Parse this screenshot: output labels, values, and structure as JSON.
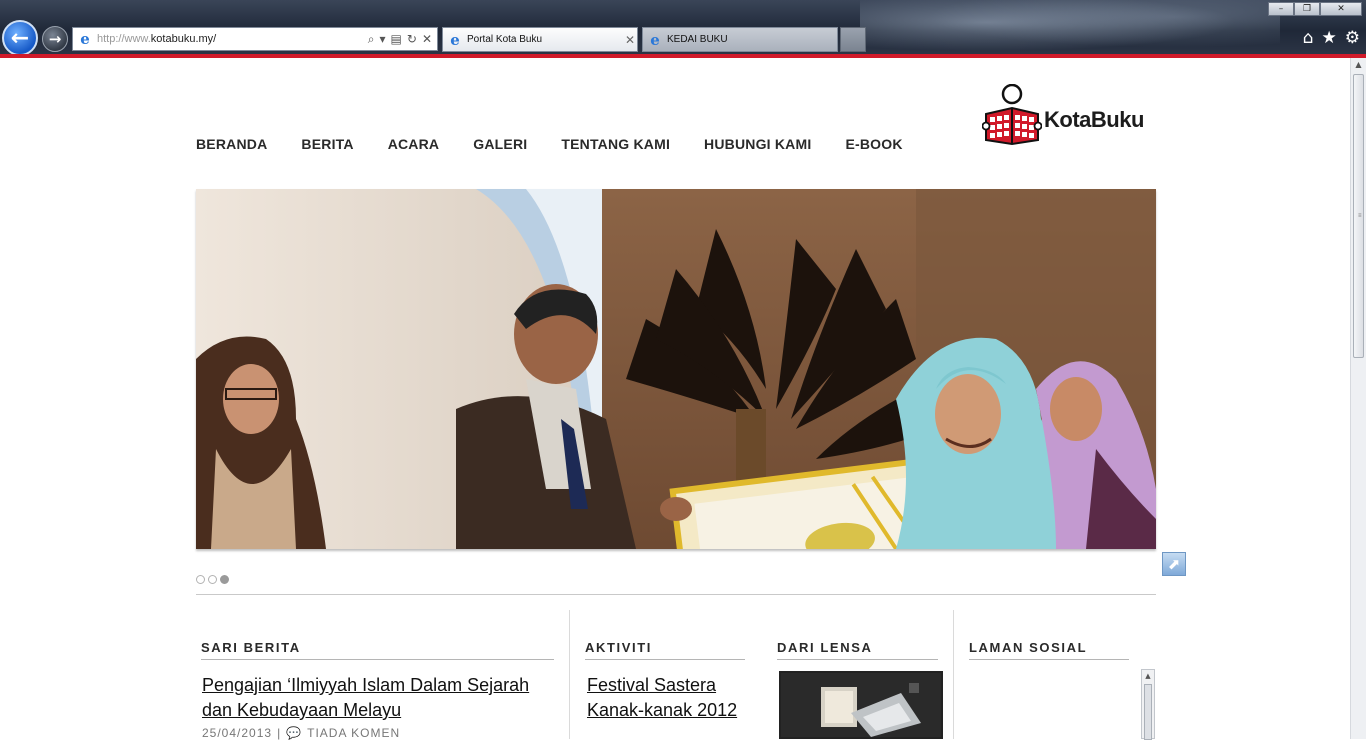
{
  "browser": {
    "address": {
      "prefix": "http://www.",
      "domain": "kotabuku.my/"
    },
    "tabs": [
      {
        "label": "Portal Kota Buku",
        "active": true
      },
      {
        "label": "KEDAI BUKU",
        "active": false
      }
    ]
  },
  "site": {
    "logo_text": "KotaBuku",
    "nav": [
      "BERANDA",
      "BERITA",
      "ACARA",
      "GALERI",
      "TENTANG KAMI",
      "HUBUNGI KAMI",
      "E-BOOK"
    ],
    "slider": {
      "slide_count": 3,
      "active_index": 2
    },
    "sections": {
      "sari_berita": {
        "title": "SARI BERITA",
        "headline": "Pengajian ‘Ilmiyyah Islam Dalam Sejarah dan Kebudayaan Melayu",
        "date": "25/04/2013",
        "separator": "|",
        "comments": "TIADA KOMEN"
      },
      "aktiviti": {
        "title": "AKTIVITI",
        "headline": "Festival Sastera Kanak-kanak 2012"
      },
      "dari_lensa": {
        "title": "DARI LENSA"
      },
      "laman_sosial": {
        "title": "LAMAN SOSIAL"
      }
    }
  },
  "colors": {
    "accent_red": "#d11a2a",
    "ie_blue": "#1659c7"
  }
}
